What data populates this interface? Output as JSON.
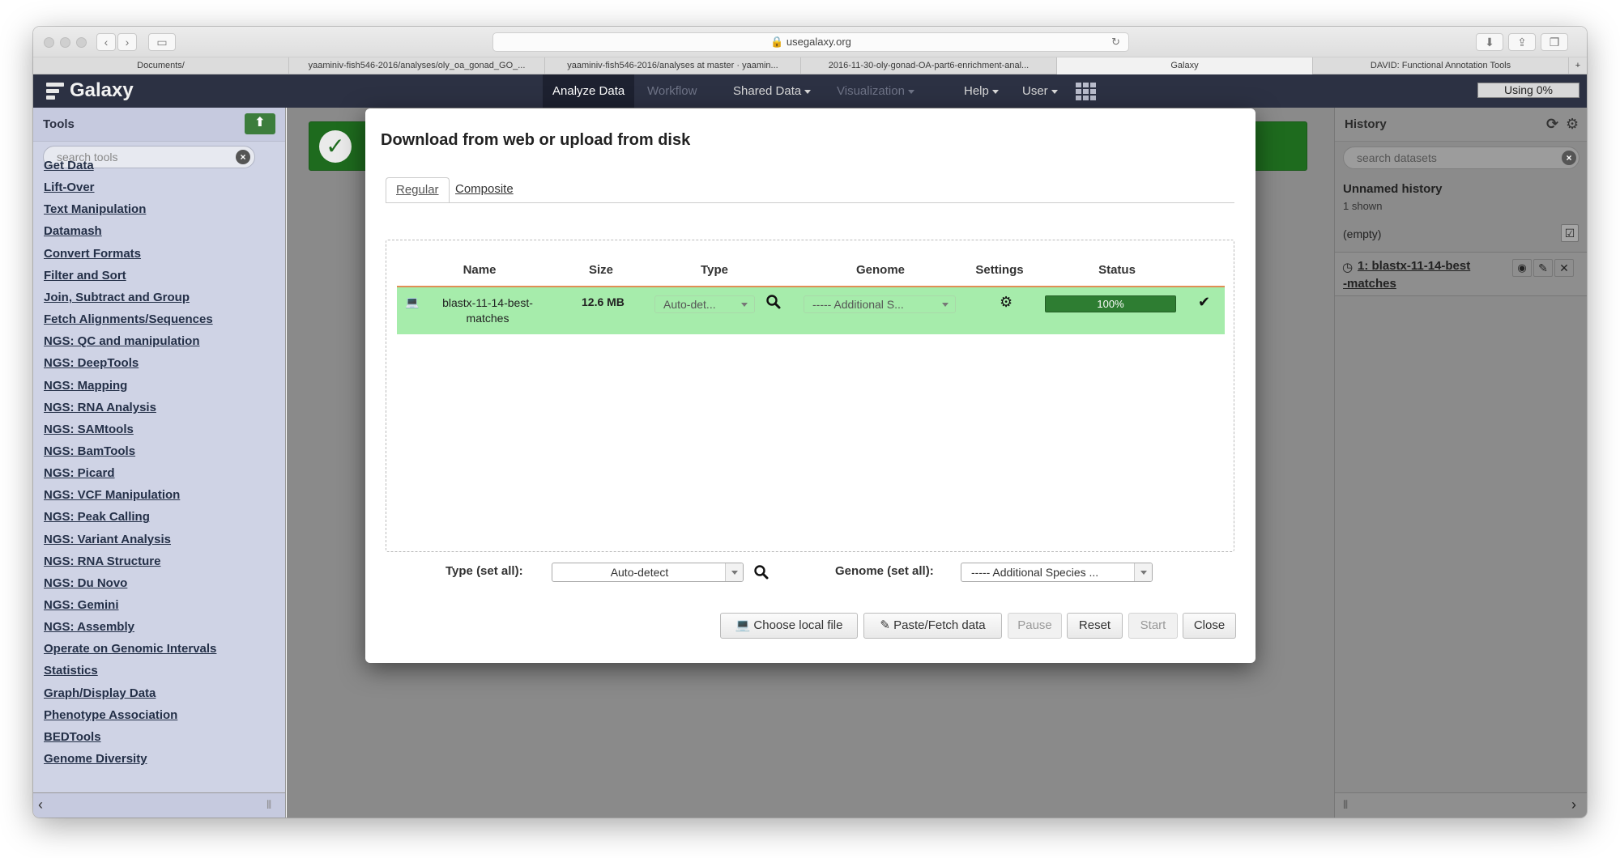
{
  "browser": {
    "address": "usegalaxy.org",
    "tabs": [
      {
        "label": "Documents/"
      },
      {
        "label": "yaaminiv-fish546-2016/analyses/oly_oa_gonad_GO_..."
      },
      {
        "label": "yaaminiv-fish546-2016/analyses at master · yaamin..."
      },
      {
        "label": "2016-11-30-oly-gonad-OA-part6-enrichment-anal..."
      },
      {
        "label": "Galaxy"
      },
      {
        "label": "DAVID: Functional Annotation Tools"
      }
    ],
    "new_tab": "+"
  },
  "galaxy": {
    "brand": "Galaxy",
    "menu": {
      "analyze": "Analyze Data",
      "workflow": "Workflow",
      "shared": "Shared Data",
      "visualization": "Visualization",
      "help": "Help",
      "user": "User"
    },
    "quota": "Using 0%"
  },
  "tools": {
    "title": "Tools",
    "search_placeholder": "search tools",
    "categories": [
      "Get Data",
      "Lift-Over",
      "Text Manipulation",
      "Datamash",
      "Convert Formats",
      "Filter and Sort",
      "Join, Subtract and Group",
      "Fetch Alignments/Sequences",
      "NGS: QC and manipulation",
      "NGS: DeepTools",
      "NGS: Mapping",
      "NGS: RNA Analysis",
      "NGS: SAMtools",
      "NGS: BamTools",
      "NGS: Picard",
      "NGS: VCF Manipulation",
      "NGS: Peak Calling",
      "NGS: Variant Analysis",
      "NGS: RNA Structure",
      "NGS: Du Novo",
      "NGS: Gemini",
      "NGS: Assembly",
      "Operate on Genomic Intervals",
      "Statistics",
      "Graph/Display Data",
      "Phenotype Association",
      "BEDTools",
      "Genome Diversity"
    ]
  },
  "history": {
    "title": "History",
    "search_placeholder": "search datasets",
    "name": "Unnamed history",
    "shown": "1 shown",
    "size": "(empty)",
    "dataset_line1": "1: blastx-11-14-best",
    "dataset_line2": "-matches"
  },
  "upload": {
    "title": "Download from web or upload from disk",
    "tabs": {
      "regular": "Regular",
      "composite": "Composite"
    },
    "columns": {
      "name": "Name",
      "size": "Size",
      "type": "Type",
      "genome": "Genome",
      "settings": "Settings",
      "status": "Status"
    },
    "row": {
      "name_line1": "blastx-11-14-best-",
      "name_line2": "matches",
      "size": "12.6 MB",
      "type": "Auto-det...",
      "genome": "----- Additional S...",
      "progress_text": "100%",
      "progress": 1.0
    },
    "type_all_label": "Type (set all):",
    "type_all_value": "Auto-detect",
    "genome_all_label": "Genome (set all):",
    "genome_all_value": "----- Additional Species ...",
    "buttons": {
      "choose": "Choose local file",
      "paste": "Paste/Fetch data",
      "pause": "Pause",
      "reset": "Reset",
      "start": "Start",
      "close": "Close"
    }
  },
  "colors": {
    "nav": "#2c3143",
    "tool_panel": "#cfd3e5",
    "row_success": "#a6ecab",
    "progress": "#2e7d32"
  }
}
